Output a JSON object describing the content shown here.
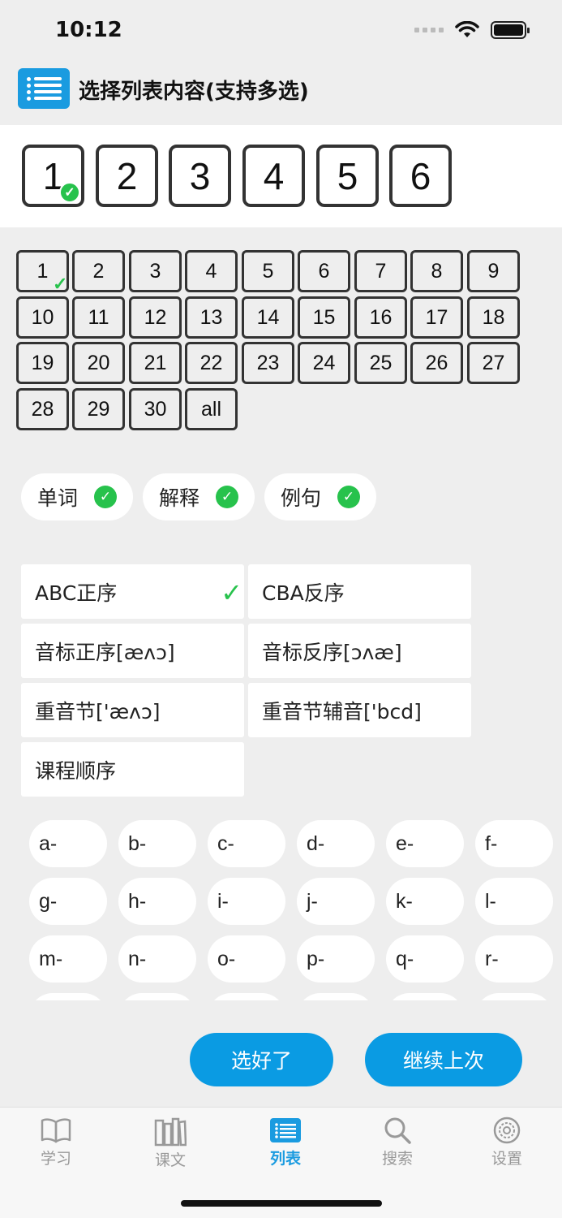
{
  "status": {
    "time": "10:12"
  },
  "header": {
    "title": "选择列表内容(支持多选)"
  },
  "volumes": [
    {
      "label": "1",
      "selected": true
    },
    {
      "label": "2",
      "selected": false
    },
    {
      "label": "3",
      "selected": false
    },
    {
      "label": "4",
      "selected": false
    },
    {
      "label": "5",
      "selected": false
    },
    {
      "label": "6",
      "selected": false
    }
  ],
  "lessons": [
    {
      "label": "1",
      "selected": true
    },
    {
      "label": "2"
    },
    {
      "label": "3"
    },
    {
      "label": "4"
    },
    {
      "label": "5"
    },
    {
      "label": "6"
    },
    {
      "label": "7"
    },
    {
      "label": "8"
    },
    {
      "label": "9"
    },
    {
      "label": "10"
    },
    {
      "label": "11"
    },
    {
      "label": "12"
    },
    {
      "label": "13"
    },
    {
      "label": "14"
    },
    {
      "label": "15"
    },
    {
      "label": "16"
    },
    {
      "label": "17"
    },
    {
      "label": "18"
    },
    {
      "label": "19"
    },
    {
      "label": "20"
    },
    {
      "label": "21"
    },
    {
      "label": "22"
    },
    {
      "label": "23"
    },
    {
      "label": "24"
    },
    {
      "label": "25"
    },
    {
      "label": "26"
    },
    {
      "label": "27"
    },
    {
      "label": "28"
    },
    {
      "label": "29"
    },
    {
      "label": "30"
    },
    {
      "label": "all"
    }
  ],
  "content_types": [
    {
      "label": "单词",
      "checked": true
    },
    {
      "label": "解释",
      "checked": true
    },
    {
      "label": "例句",
      "checked": true
    }
  ],
  "sort_options": [
    {
      "label": "ABC正序",
      "selected": true
    },
    {
      "label": "CBA反序",
      "selected": false
    },
    {
      "label": "音标正序[æʌɔ]",
      "selected": false
    },
    {
      "label": "音标反序[ɔʌæ]",
      "selected": false
    },
    {
      "label": "重音节['æʌɔ]",
      "selected": false
    },
    {
      "label": "重音节辅音['bcd]",
      "selected": false
    },
    {
      "label": "课程顺序",
      "selected": false
    }
  ],
  "letters": [
    "a-",
    "b-",
    "c-",
    "d-",
    "e-",
    "f-",
    "g-",
    "h-",
    "i-",
    "j-",
    "k-",
    "l-",
    "m-",
    "n-",
    "o-",
    "p-",
    "q-",
    "r-",
    "",
    "",
    "",
    "",
    "",
    ""
  ],
  "actions": {
    "confirm": "选好了",
    "continue": "继续上次"
  },
  "tabs": [
    {
      "label": "学习",
      "icon": "book-icon",
      "active": false
    },
    {
      "label": "课文",
      "icon": "books-icon",
      "active": false
    },
    {
      "label": "列表",
      "icon": "list-icon",
      "active": true
    },
    {
      "label": "搜索",
      "icon": "search-icon",
      "active": false
    },
    {
      "label": "设置",
      "icon": "gear-icon",
      "active": false
    }
  ],
  "colors": {
    "accent": "#0a9be3",
    "check": "#27c24c"
  }
}
